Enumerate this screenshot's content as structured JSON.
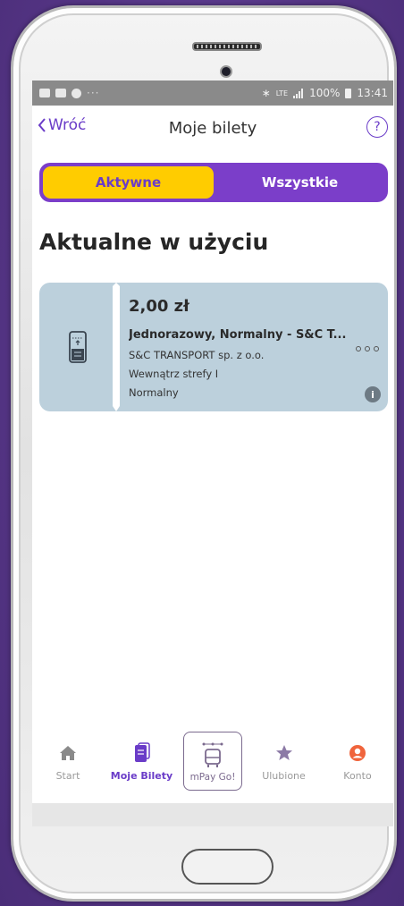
{
  "status_bar": {
    "left_icons": [
      "gallery-icon",
      "message-icon",
      "cloud-icon"
    ],
    "signal": "LTE",
    "battery": "100%",
    "time": "13:41"
  },
  "header": {
    "back_label": "Wróć",
    "title": "Moje bilety",
    "help_label": "?"
  },
  "segments": {
    "active": "Aktywne",
    "all": "Wszystkie"
  },
  "section_title": "Aktualne w użyciu",
  "ticket": {
    "price": "2,00 zł",
    "name": "Jednorazowy, Normalny - S&C T...",
    "operator": "S&C TRANSPORT sp. z o.o.",
    "zone": "Wewnątrz strefy I",
    "type": "Normalny",
    "info_label": "i"
  },
  "tabbar": {
    "items": [
      {
        "label": "Start",
        "icon": "home-icon"
      },
      {
        "label": "Moje Bilety",
        "icon": "tickets-icon"
      },
      {
        "label": "mPay Go!",
        "icon": "bus-icon"
      },
      {
        "label": "Ulubione",
        "icon": "star-icon"
      },
      {
        "label": "Konto",
        "icon": "account-icon"
      }
    ]
  },
  "colors": {
    "accent": "#6a3cc8",
    "segment_bg": "#7b3ec9",
    "segment_active": "#ffcc00",
    "ticket_bg": "#bcd0dc",
    "account": "#f0643c"
  }
}
